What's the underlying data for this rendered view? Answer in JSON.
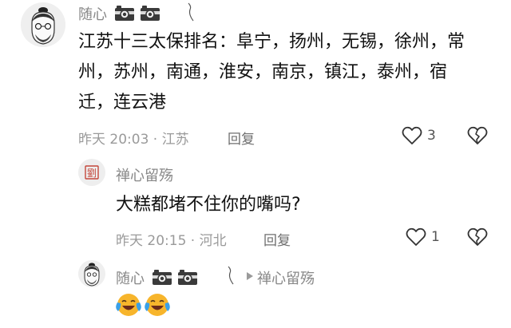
{
  "comments": [
    {
      "user": "随心",
      "text": "江苏十三太保排名：阜宁，扬州，无锡，徐州，常州，苏州，南通，淮安，南京，镇江，泰州，宿迁，连云港",
      "time_location": "昨天 20:03 · 江苏",
      "reply_label": "回复",
      "likes": "3"
    },
    {
      "user": "禅心留殇",
      "text": "大糕都堵不住你的嘴吗?",
      "time_location": "昨天 20:15 · 河北",
      "reply_label": "回复",
      "likes": "1"
    },
    {
      "user": "随心",
      "reply_to": "禅心留殇",
      "text_emojis": [
        "laughing-crying-emoji",
        "laughing-crying-emoji"
      ]
    }
  ],
  "icons": {
    "badge": "camera-badge-icon",
    "like": "heart-icon",
    "dislike": "broken-heart-icon",
    "reply_arrow": "play-triangle-icon",
    "scribble": "scribble-mark"
  },
  "colors": {
    "meta": "#9a9a9a",
    "name": "#888888",
    "emoji_face": "#f7b52c",
    "tears": "#3aa0e8"
  }
}
